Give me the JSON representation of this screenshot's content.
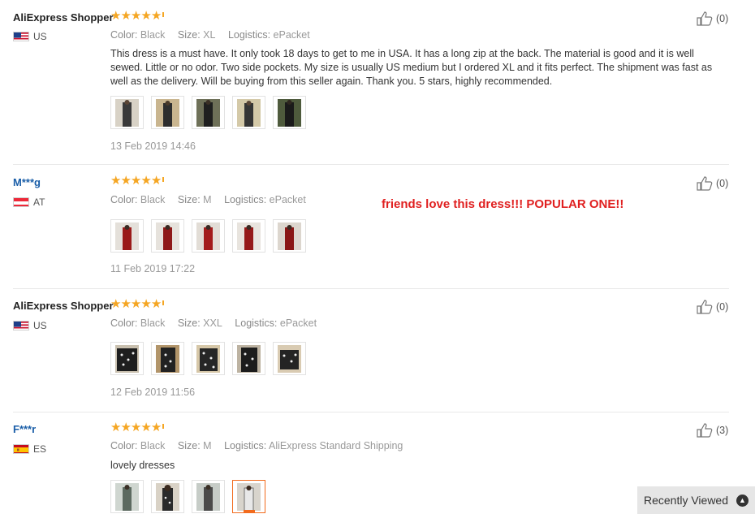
{
  "reviews": [
    {
      "user": "AliExpress Shopper",
      "country_code": "US",
      "flag": "us-flag-icon",
      "rating": 5,
      "color_label": "Color:",
      "color_value": "Black",
      "size_label": "Size:",
      "size_value": "XL",
      "logistics_label": "Logistics:",
      "logistics_value": "ePacket",
      "text": "This dress is a must have. It only took 18 days to get to me in USA. It has a long zip at the back. The material is good and it is well sewed. Little or no odor. Two side pockets. My size is usually US medium but I ordered XL and it fits perfect. The shipment was fast as well as the delivery. Will be buying from this seller again. Thank you. 5 stars, highly recommended.",
      "photo_count": 5,
      "date": "13 Feb 2019 14:46",
      "helpful": "(0)"
    },
    {
      "user": "M***g",
      "country_code": "AT",
      "flag": "at-flag-icon",
      "rating": 5,
      "color_label": "Color:",
      "color_value": "Black",
      "size_label": "Size:",
      "size_value": "M",
      "logistics_label": "Logistics:",
      "logistics_value": "ePacket",
      "highlight": "friends love this dress!!! POPULAR ONE!!",
      "photo_count": 5,
      "date": "11 Feb 2019 17:22",
      "helpful": "(0)"
    },
    {
      "user": "AliExpress Shopper",
      "country_code": "US",
      "flag": "us-flag-icon",
      "rating": 5,
      "color_label": "Color:",
      "color_value": "Black",
      "size_label": "Size:",
      "size_value": "XXL",
      "logistics_label": "Logistics:",
      "logistics_value": "ePacket",
      "photo_count": 5,
      "date": "12 Feb 2019 11:56",
      "helpful": "(0)"
    },
    {
      "user": "F***r",
      "country_code": "ES",
      "flag": "es-flag-icon",
      "rating": 5,
      "color_label": "Color:",
      "color_value": "Black",
      "size_label": "Size:",
      "size_value": "M",
      "logistics_label": "Logistics:",
      "logistics_value": "AliExpress Standard Shipping",
      "text": "lovely dresses",
      "photo_count": 4,
      "selected_photo": 4,
      "helpful": "(3)"
    }
  ],
  "recently_viewed": {
    "label": "Recently Viewed",
    "icon": "chevron-up-icon"
  },
  "colors": {
    "star": "#f5a623",
    "highlight": "#e02020",
    "username_link": "#1a5ea8",
    "selected_thumb": "#f26b1d"
  }
}
